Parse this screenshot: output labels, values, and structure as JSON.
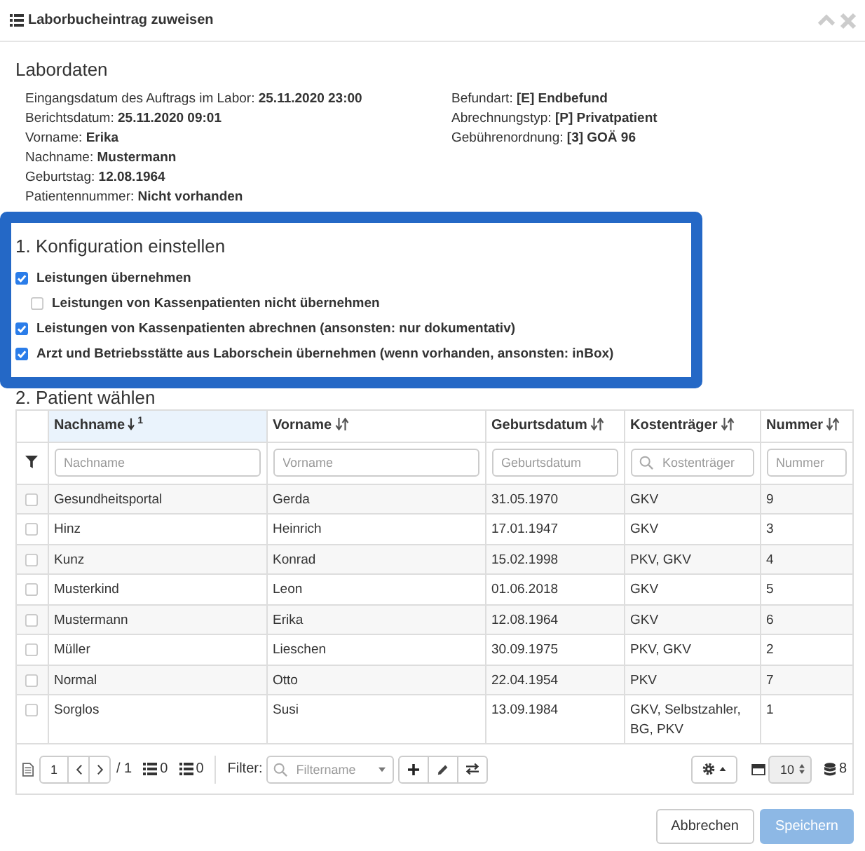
{
  "window": {
    "title": "Laborbucheintrag zuweisen"
  },
  "lab_data": {
    "heading": "Labordaten",
    "left": [
      {
        "label": "Eingangsdatum des Auftrags im Labor:",
        "value": "25.11.2020 23:00"
      },
      {
        "label": "Berichtsdatum:",
        "value": "25.11.2020 09:01"
      },
      {
        "label": "Vorname:",
        "value": "Erika"
      },
      {
        "label": "Nachname:",
        "value": "Mustermann"
      },
      {
        "label": "Geburtstag:",
        "value": "12.08.1964"
      },
      {
        "label": "Patientennummer:",
        "value": "Nicht vorhanden"
      }
    ],
    "right": [
      {
        "label": "Befundart:",
        "value": "[E] Endbefund"
      },
      {
        "label": "Abrechnungstyp:",
        "value": "[P] Privatpatient"
      },
      {
        "label": "Gebührenordnung:",
        "value": "[3] GOÄ 96"
      }
    ]
  },
  "configuration": {
    "highlighted": true,
    "heading": "1. Konfiguration einstellen",
    "options": [
      {
        "label": "Leistungen übernehmen",
        "checked": true,
        "children": [
          {
            "label": "Leistungen von Kassenpatienten nicht übernehmen",
            "checked": false
          }
        ]
      },
      {
        "label": "Leistungen von Kassenpatienten abrechnen (ansonsten: nur dokumentativ)",
        "checked": true
      },
      {
        "label": "Arzt und Betriebsstätte aus Laborschein übernehmen (wenn vorhanden, ansonsten: inBox)",
        "checked": true
      }
    ]
  },
  "patient_selection": {
    "heading": "2. Patient wählen",
    "table": {
      "columns": [
        {
          "label": "Nachname",
          "sorted": true,
          "sort_rank": "1"
        },
        {
          "label": "Vorname",
          "sorted": false
        },
        {
          "label": "Geburtsdatum",
          "sorted": false
        },
        {
          "label": "Kostenträger",
          "sorted": false
        },
        {
          "label": "Nummer",
          "sorted": false
        }
      ],
      "filters": [
        {
          "kind": "text",
          "placeholder": "Nachname"
        },
        {
          "kind": "text",
          "placeholder": "Vorname"
        },
        {
          "kind": "text",
          "placeholder": "Geburtsdatum"
        },
        {
          "kind": "search",
          "placeholder": "Kostenträger"
        },
        {
          "kind": "text",
          "placeholder": "Nummer"
        }
      ],
      "rows": [
        {
          "selected": false,
          "cells": [
            "Gesundheitsportal",
            "Gerda",
            "31.05.1970",
            "GKV",
            "9"
          ]
        },
        {
          "selected": false,
          "cells": [
            "Hinz",
            "Heinrich",
            "17.01.1947",
            "GKV",
            "3"
          ]
        },
        {
          "selected": false,
          "cells": [
            "Kunz",
            "Konrad",
            "15.02.1998",
            "PKV, GKV",
            "4"
          ]
        },
        {
          "selected": false,
          "cells": [
            "Musterkind",
            "Leon",
            "01.06.2018",
            "GKV",
            "5"
          ]
        },
        {
          "selected": false,
          "cells": [
            "Mustermann",
            "Erika",
            "12.08.1964",
            "GKV",
            "6"
          ]
        },
        {
          "selected": false,
          "cells": [
            "Müller",
            "Lieschen",
            "30.09.1975",
            "PKV, GKV",
            "2"
          ]
        },
        {
          "selected": false,
          "cells": [
            "Normal",
            "Otto",
            "22.04.1954",
            "PKV",
            "7"
          ]
        },
        {
          "selected": false,
          "cells": [
            "Sorglos",
            "Susi",
            "13.09.1984",
            "GKV, Selbstzahler, BG, PKV",
            "1"
          ]
        }
      ]
    },
    "footer": {
      "page": "1",
      "page_total": "/ 1",
      "counts": [
        "0",
        "0"
      ],
      "filter_label": "Filter:",
      "filter_placeholder": "Filtername",
      "page_size": "10",
      "record_count": "8"
    }
  },
  "buttons": [
    {
      "label": "Abbrechen",
      "kind": "secondary",
      "disabled": false
    },
    {
      "label": "Speichern",
      "kind": "primary",
      "disabled": true
    }
  ]
}
